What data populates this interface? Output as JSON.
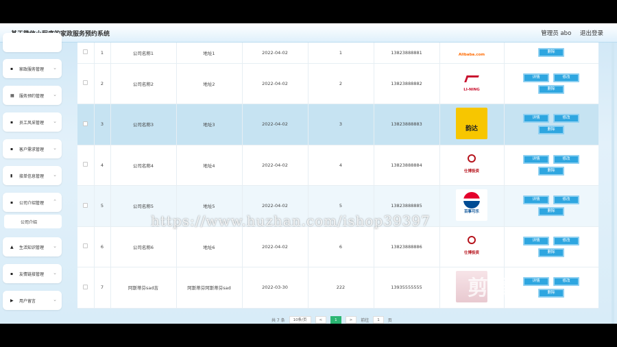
{
  "header": {
    "title": "基于微信小程序的家政服务预约系统",
    "user_label": "管理员 abo",
    "logout_label": "退出登录"
  },
  "sidebar": {
    "items": [
      {
        "label": "家政服务管理",
        "icon": "▪"
      },
      {
        "label": "服务预约管理",
        "icon": "▦"
      },
      {
        "label": "员工风采管理",
        "icon": "▪"
      },
      {
        "label": "客户需求管理",
        "icon": "▪"
      },
      {
        "label": "接单信息管理",
        "icon": "▮"
      },
      {
        "label": "公司介绍管理",
        "icon": "▪"
      },
      {
        "label": "生活知识管理",
        "icon": "▲"
      },
      {
        "label": "友情链接管理",
        "icon": "▪"
      },
      {
        "label": "用户留言",
        "icon": "▶"
      }
    ],
    "sub_item": "公司介绍"
  },
  "table": {
    "rows": [
      {
        "no": "1",
        "name": "公司名称1",
        "address": "地址1",
        "date": "2022-04-02",
        "count": "1",
        "phone": "13823888881",
        "logo_text": "Alibaba.com",
        "logo_color": "#ff6a00"
      },
      {
        "no": "2",
        "name": "公司名称2",
        "address": "地址2",
        "date": "2022-04-02",
        "count": "2",
        "phone": "13823888882",
        "logo_text": "LI-NING",
        "logo_color": "#c8102e"
      },
      {
        "no": "3",
        "name": "公司名称3",
        "address": "地址3",
        "date": "2022-04-02",
        "count": "3",
        "phone": "13823888883",
        "logo_text": "韵达",
        "logo_color": "#f7c600"
      },
      {
        "no": "4",
        "name": "公司名称4",
        "address": "地址4",
        "date": "2022-04-02",
        "count": "4",
        "phone": "13823888884",
        "logo_text": "仕博投资",
        "logo_color": "#b5121b"
      },
      {
        "no": "5",
        "name": "公司名称5",
        "address": "地址5",
        "date": "2022-04-02",
        "count": "5",
        "phone": "13823888885",
        "logo_text": "百事可乐",
        "logo_color": "#004b93"
      },
      {
        "no": "6",
        "name": "公司名称6",
        "address": "地址6",
        "date": "2022-04-02",
        "count": "6",
        "phone": "13823888886",
        "logo_text": "仕博投资",
        "logo_color": "#b5121b"
      },
      {
        "no": "7",
        "name": "阿斯蒂芬sad吉",
        "address": "阿斯蒂芬阿斯蒂芬sad",
        "date": "2022-03-30",
        "count": "222",
        "phone": "13935555555",
        "logo_text": "",
        "logo_color": "#f3d7dc"
      }
    ],
    "btn_detail": "详情",
    "btn_edit": "修改",
    "btn_delete": "删除"
  },
  "pager": {
    "total": "共 7 条",
    "page_size": "10条/页",
    "prev": "<",
    "current": "1",
    "next": ">",
    "goto_label": "前往",
    "goto_value": "1",
    "page_suffix": "页"
  },
  "overlay": {
    "watermark": "https://www.huzhan.com/ishop39397",
    "video_logo": "剪辑"
  },
  "colors": {
    "accent": "#2ea6e0",
    "highlight_row": "#c6e3f2",
    "pager_current": "#2bb673"
  }
}
